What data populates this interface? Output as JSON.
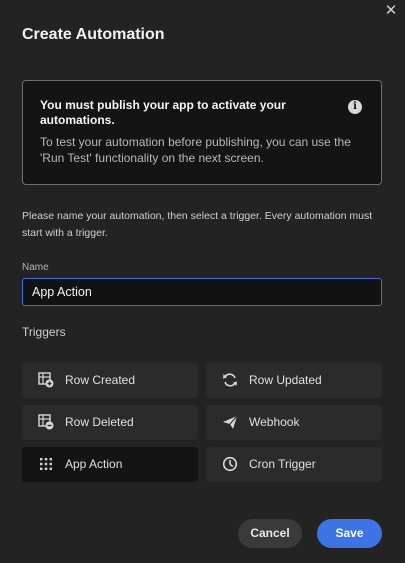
{
  "dialog": {
    "title": "Create Automation",
    "close_icon": "close-icon"
  },
  "notice": {
    "heading": "You must publish your app to activate your automations.",
    "body": "To test your automation before publishing, you can use the 'Run Test' functionality on the next screen.",
    "icon": "info-icon"
  },
  "instructions": "Please name your automation, then select a trigger. Every automation must start with a trigger.",
  "name_field": {
    "label": "Name",
    "value": "App Action"
  },
  "triggers": {
    "label": "Triggers",
    "items": [
      {
        "label": "Row Created",
        "icon": "table-add-icon",
        "selected": false
      },
      {
        "label": "Row Updated",
        "icon": "refresh-icon",
        "selected": false
      },
      {
        "label": "Row Deleted",
        "icon": "table-remove-icon",
        "selected": false
      },
      {
        "label": "Webhook",
        "icon": "send-icon",
        "selected": false
      },
      {
        "label": "App Action",
        "icon": "grid-dots-icon",
        "selected": true
      },
      {
        "label": "Cron Trigger",
        "icon": "clock-icon",
        "selected": false
      }
    ]
  },
  "buttons": {
    "cancel": "Cancel",
    "save": "Save"
  },
  "colors": {
    "accent": "#3d74e5",
    "background": "#232323",
    "selected_trigger": "#141414"
  }
}
